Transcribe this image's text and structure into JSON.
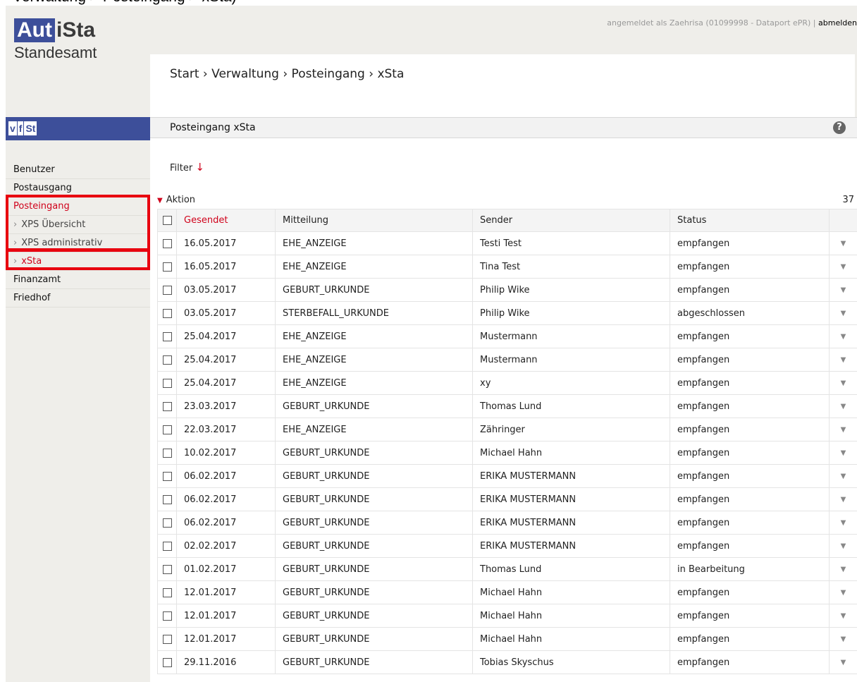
{
  "caption": "Verwaltung > Posteingang > xSta)",
  "logo": {
    "boxed": "Aut",
    "rest": "iSta"
  },
  "subtitle": "Standesamt",
  "login": {
    "text": "angemeldet als Zaehrisa (01099998 - Dataport ePR)",
    "separator": " | ",
    "logout_label": "abmelden"
  },
  "breadcrumb": "Start › Verwaltung › Posteingang › xSta",
  "vfst": [
    "v",
    "f",
    "St"
  ],
  "sidebar": {
    "items": [
      {
        "label": "Benutzer"
      },
      {
        "label": "Postausgang"
      },
      {
        "label": "Posteingang"
      },
      {
        "label": "XPS Übersicht"
      },
      {
        "label": "XPS administrativ"
      },
      {
        "label": "xSta"
      },
      {
        "label": "Finanzamt"
      },
      {
        "label": "Friedhof"
      }
    ],
    "sub_arrow": "›"
  },
  "panel": {
    "title": "Posteingang xSta",
    "help_icon": "?",
    "filter_label": "Filter",
    "filter_arrow": "↓",
    "aktion_label": "Aktion",
    "count": "37"
  },
  "table": {
    "headers": [
      "Gesendet",
      "Mitteilung",
      "Sender",
      "Status"
    ],
    "rows": [
      [
        "16.05.2017",
        "EHE_ANZEIGE",
        "Testi Test",
        "empfangen"
      ],
      [
        "16.05.2017",
        "EHE_ANZEIGE",
        "Tina Test",
        "empfangen"
      ],
      [
        "03.05.2017",
        "GEBURT_URKUNDE",
        "Philip Wike",
        "empfangen"
      ],
      [
        "03.05.2017",
        "STERBEFALL_URKUNDE",
        "Philip Wike",
        "abgeschlossen"
      ],
      [
        "25.04.2017",
        "EHE_ANZEIGE",
        "Mustermann",
        "empfangen"
      ],
      [
        "25.04.2017",
        "EHE_ANZEIGE",
        "Mustermann",
        "empfangen"
      ],
      [
        "25.04.2017",
        "EHE_ANZEIGE",
        "xy",
        "empfangen"
      ],
      [
        "23.03.2017",
        "GEBURT_URKUNDE",
        "Thomas Lund",
        "empfangen"
      ],
      [
        "22.03.2017",
        "EHE_ANZEIGE",
        "Zähringer",
        "empfangen"
      ],
      [
        "10.02.2017",
        "GEBURT_URKUNDE",
        "Michael Hahn",
        "empfangen"
      ],
      [
        "06.02.2017",
        "GEBURT_URKUNDE",
        "ERIKA MUSTERMANN",
        "empfangen"
      ],
      [
        "06.02.2017",
        "GEBURT_URKUNDE",
        "ERIKA MUSTERMANN",
        "empfangen"
      ],
      [
        "06.02.2017",
        "GEBURT_URKUNDE",
        "ERIKA MUSTERMANN",
        "empfangen"
      ],
      [
        "02.02.2017",
        "GEBURT_URKUNDE",
        "ERIKA MUSTERMANN",
        "empfangen"
      ],
      [
        "01.02.2017",
        "GEBURT_URKUNDE",
        "Thomas Lund",
        "in Bearbeitung"
      ],
      [
        "12.01.2017",
        "GEBURT_URKUNDE",
        "Michael Hahn",
        "empfangen"
      ],
      [
        "12.01.2017",
        "GEBURT_URKUNDE",
        "Michael Hahn",
        "empfangen"
      ],
      [
        "12.01.2017",
        "GEBURT_URKUNDE",
        "Michael Hahn",
        "empfangen"
      ],
      [
        "29.11.2016",
        "GEBURT_URKUNDE",
        "Tobias Skyschus",
        "empfangen"
      ]
    ],
    "row_menu_icon": "▼"
  },
  "colors": {
    "brand": "#3d4f9a",
    "accent": "#d0021b",
    "highlight": "#e8000f"
  }
}
